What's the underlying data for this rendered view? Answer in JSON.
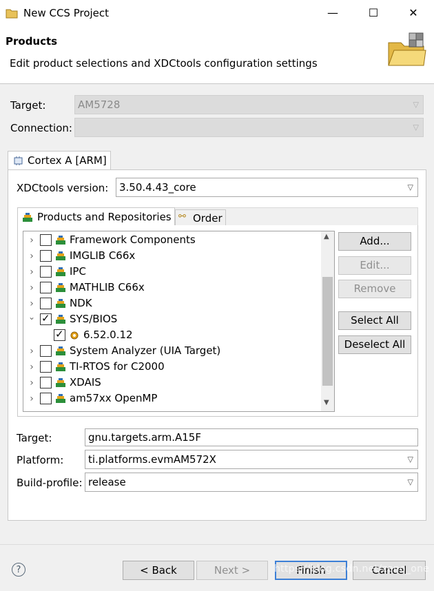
{
  "window": {
    "title": "New CCS Project",
    "minimize": "—",
    "maximize": "☐",
    "close": "✕"
  },
  "header": {
    "title": "Products",
    "subtitle": "Edit product selections and XDCtools configuration settings"
  },
  "device": {
    "target_label": "Target:",
    "target_value": "AM5728",
    "connection_label": "Connection:",
    "connection_value": ""
  },
  "tab": {
    "label": "Cortex A [ARM]"
  },
  "xdctools": {
    "label": "XDCtools version:",
    "value": "3.50.4.43_core"
  },
  "subtabs": [
    {
      "label": "Products and Repositories"
    },
    {
      "label": "Order"
    }
  ],
  "tree": {
    "items": [
      {
        "label": "Framework Components",
        "expanded": false,
        "checked": false,
        "level": 0
      },
      {
        "label": "IMGLIB C66x",
        "expanded": false,
        "checked": false,
        "level": 0
      },
      {
        "label": "IPC",
        "expanded": false,
        "checked": false,
        "level": 0
      },
      {
        "label": "MATHLIB C66x",
        "expanded": false,
        "checked": false,
        "level": 0
      },
      {
        "label": "NDK",
        "expanded": false,
        "checked": false,
        "level": 0
      },
      {
        "label": "SYS/BIOS",
        "expanded": true,
        "checked": true,
        "level": 0
      },
      {
        "label": "6.52.0.12",
        "expanded": false,
        "checked": true,
        "level": 1
      },
      {
        "label": "System Analyzer (UIA Target)",
        "expanded": false,
        "checked": false,
        "level": 0
      },
      {
        "label": "TI-RTOS for C2000",
        "expanded": false,
        "checked": false,
        "level": 0
      },
      {
        "label": "XDAIS",
        "expanded": false,
        "checked": false,
        "level": 0
      },
      {
        "label": "am57xx OpenMP",
        "expanded": false,
        "checked": false,
        "level": 0
      }
    ]
  },
  "side_buttons": {
    "add": "Add...",
    "edit": "Edit...",
    "remove": "Remove",
    "select_all": "Select All",
    "deselect_all": "Deselect All"
  },
  "build": {
    "target_label": "Target:",
    "target_value": "gnu.targets.arm.A15F",
    "platform_label": "Platform:",
    "platform_value": "ti.platforms.evmAM572X",
    "profile_label": "Build-profile:",
    "profile_value": "release"
  },
  "footer": {
    "back": "< Back",
    "next": "Next >",
    "finish": "Finish",
    "cancel": "Cancel",
    "help": "?"
  },
  "watermark": "https://blog.csdn.net/zeno_one"
}
